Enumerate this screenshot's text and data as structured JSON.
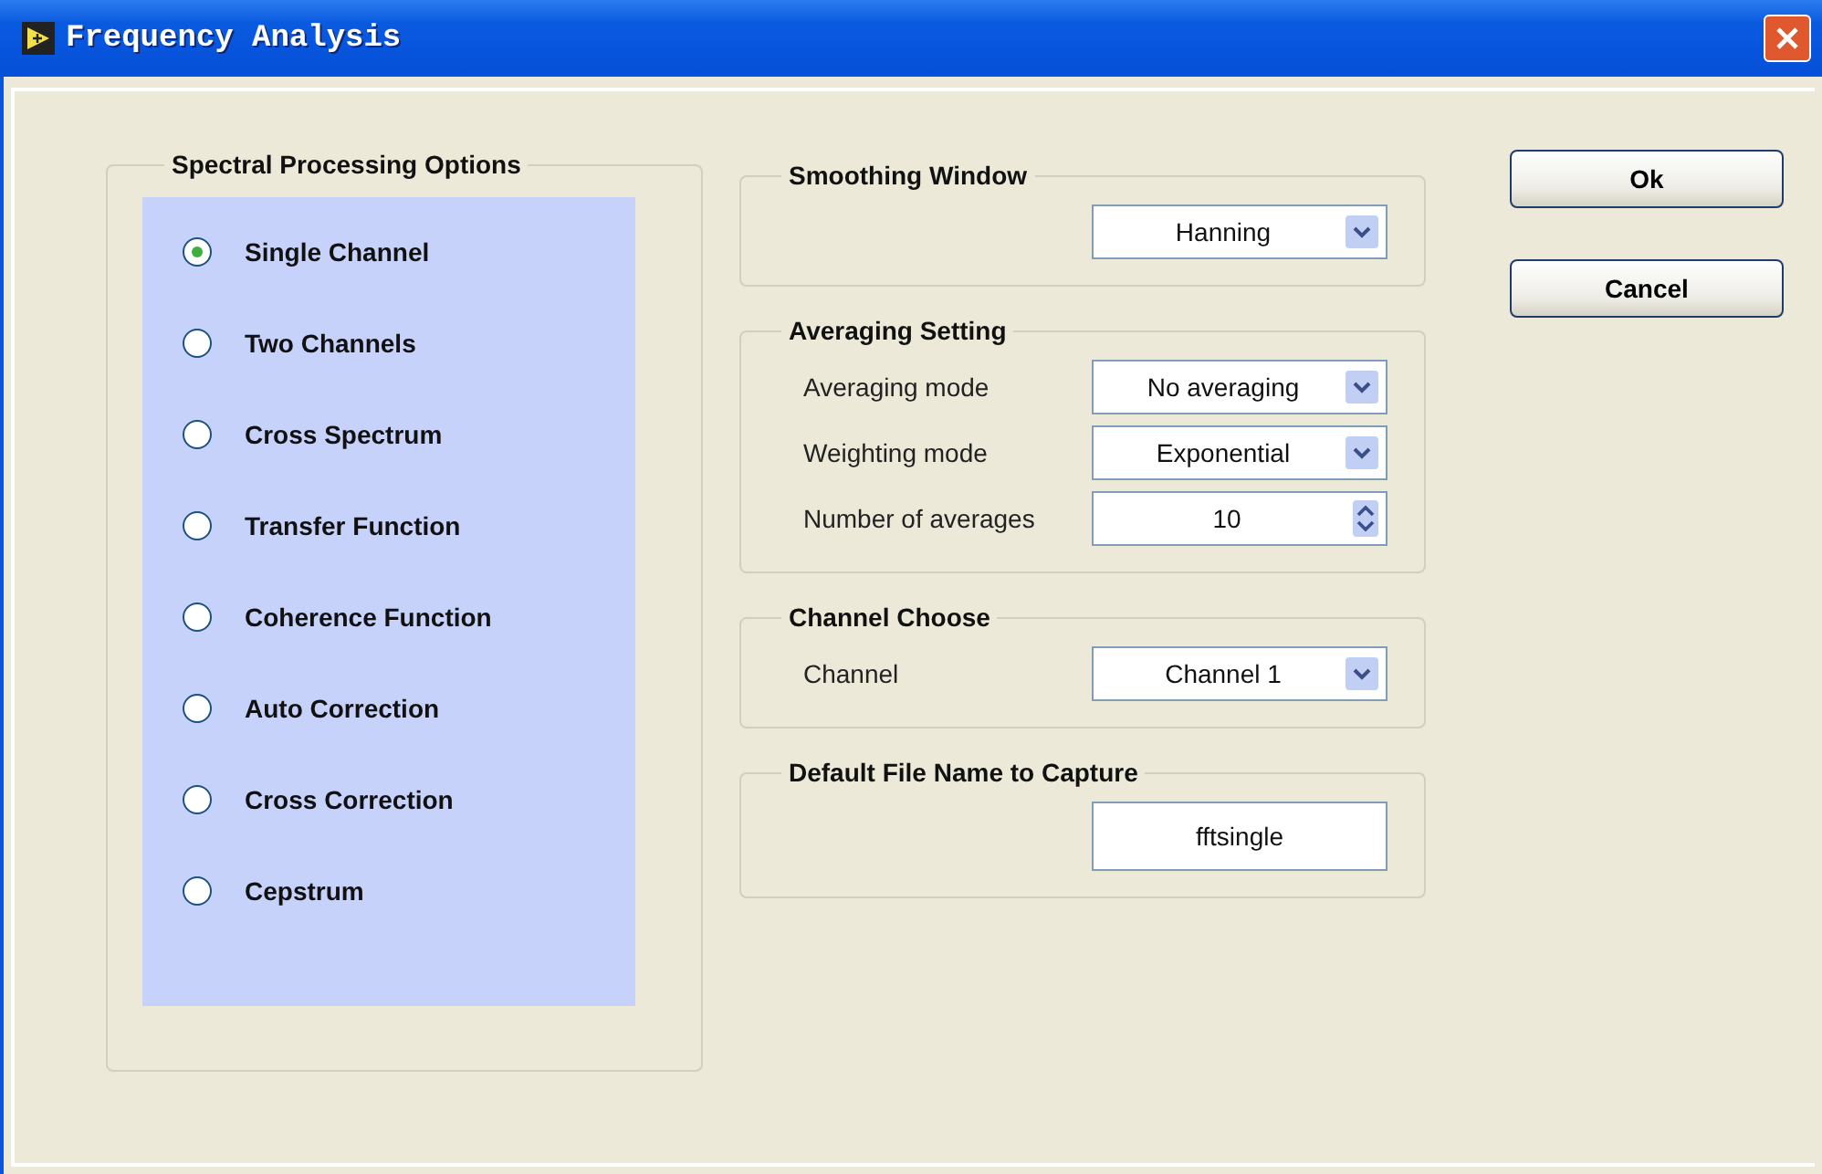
{
  "window": {
    "title": "Frequency Analysis"
  },
  "spectral": {
    "title": "Spectral Processing Options",
    "options": [
      {
        "label": "Single Channel",
        "selected": true
      },
      {
        "label": "Two Channels",
        "selected": false
      },
      {
        "label": "Cross Spectrum",
        "selected": false
      },
      {
        "label": "Transfer Function",
        "selected": false
      },
      {
        "label": "Coherence Function",
        "selected": false
      },
      {
        "label": "Auto Correction",
        "selected": false
      },
      {
        "label": "Cross Correction",
        "selected": false
      },
      {
        "label": "Cepstrum",
        "selected": false
      }
    ]
  },
  "groups": [
    {
      "title": "Smoothing Window",
      "fields": [
        {
          "kind": "dropdown",
          "value": "Hanning"
        }
      ]
    },
    {
      "title": "Averaging Setting",
      "fields": [
        {
          "kind": "dropdown",
          "label": "Averaging mode",
          "value": "No averaging"
        },
        {
          "kind": "dropdown",
          "label": "Weighting mode",
          "value": "Exponential"
        },
        {
          "kind": "spinner",
          "label": "Number of averages",
          "value": "10"
        }
      ]
    },
    {
      "title": "Channel Choose",
      "fields": [
        {
          "kind": "dropdown",
          "label": "Channel",
          "value": "Channel 1"
        }
      ]
    },
    {
      "title": "Default File Name to Capture",
      "fields": [
        {
          "kind": "text",
          "value": "fftsingle"
        }
      ]
    }
  ],
  "buttons": [
    "Ok",
    "Cancel"
  ]
}
